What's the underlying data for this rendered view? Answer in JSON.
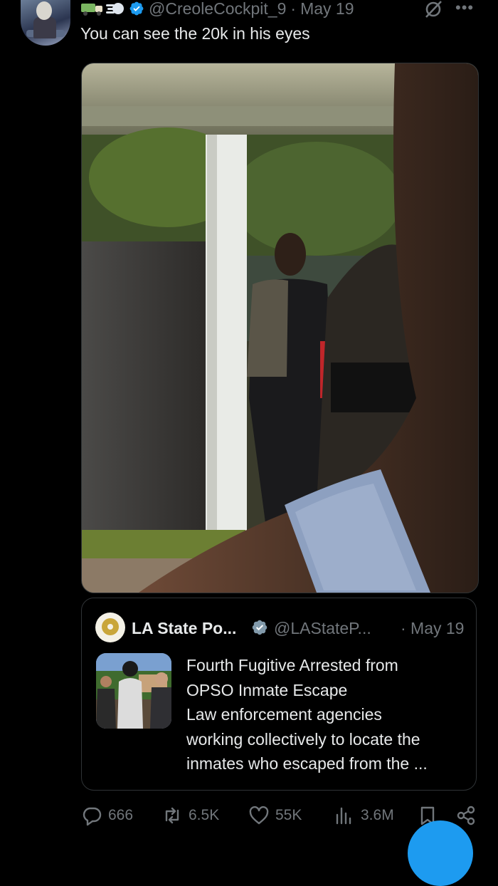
{
  "tweet": {
    "emoji": [
      "truck-emoji",
      "dash-emoji"
    ],
    "handle": "@CreoleCockpit_9",
    "separator": "·",
    "date": "May 19",
    "text": "You can see the 20k in his eyes"
  },
  "quoted_tweet": {
    "name": "LA State Po...",
    "handle": "@LAStateP...",
    "date": "· May 19",
    "body_lines": [
      "Fourth Fugitive Arrested from",
      "OPSO Inmate Escape",
      "Law enforcement agencies",
      "working collectively to locate the",
      "inmates who escaped from the ..."
    ]
  },
  "actions": {
    "replies": "666",
    "reposts": "6.5K",
    "likes": "55K",
    "views": "3.6M"
  },
  "icons": {
    "verified": "verified-badge-icon",
    "grok": "grok-icon",
    "more": "more-icon",
    "reply": "reply-icon",
    "repost": "repost-icon",
    "like": "heart-icon",
    "views": "views-icon",
    "bookmark": "bookmark-icon",
    "share": "share-icon"
  },
  "colors": {
    "background": "#000000",
    "text": "#e7e9ea",
    "secondary": "#71767b",
    "border": "#2f3336",
    "accent": "#1d9bf0"
  }
}
